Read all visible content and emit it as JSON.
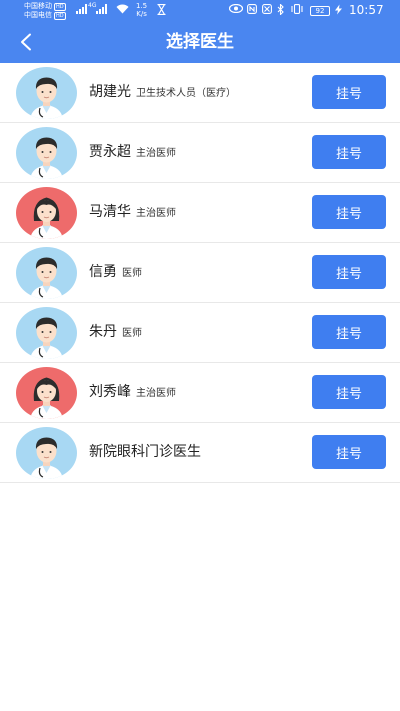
{
  "status_bar": {
    "carrier1": "中国移动",
    "carrier2": "中国电信",
    "hd": "HD",
    "network": "4G",
    "speed_value": "1.5",
    "speed_unit": "K/s",
    "battery": "92",
    "time": "10:57"
  },
  "header": {
    "title": "选择医生"
  },
  "colors": {
    "header_bg": "#4a86f0",
    "button_bg": "#3f7ef0",
    "avatar_blue": "#a8d8f3",
    "avatar_red": "#ee6b6b"
  },
  "doctors": [
    {
      "name": "胡建光",
      "title": "卫生技术人员（医疗）",
      "button": "挂号",
      "avatar": "male"
    },
    {
      "name": "贾永超",
      "title": "主治医师",
      "button": "挂号",
      "avatar": "male"
    },
    {
      "name": "马清华",
      "title": "主治医师",
      "button": "挂号",
      "avatar": "female"
    },
    {
      "name": "信勇",
      "title": "医师",
      "button": "挂号",
      "avatar": "male"
    },
    {
      "name": "朱丹",
      "title": "医师",
      "button": "挂号",
      "avatar": "male"
    },
    {
      "name": "刘秀峰",
      "title": "主治医师",
      "button": "挂号",
      "avatar": "female"
    },
    {
      "name": "新院眼科门诊医生",
      "title": "",
      "button": "挂号",
      "avatar": "male"
    }
  ]
}
